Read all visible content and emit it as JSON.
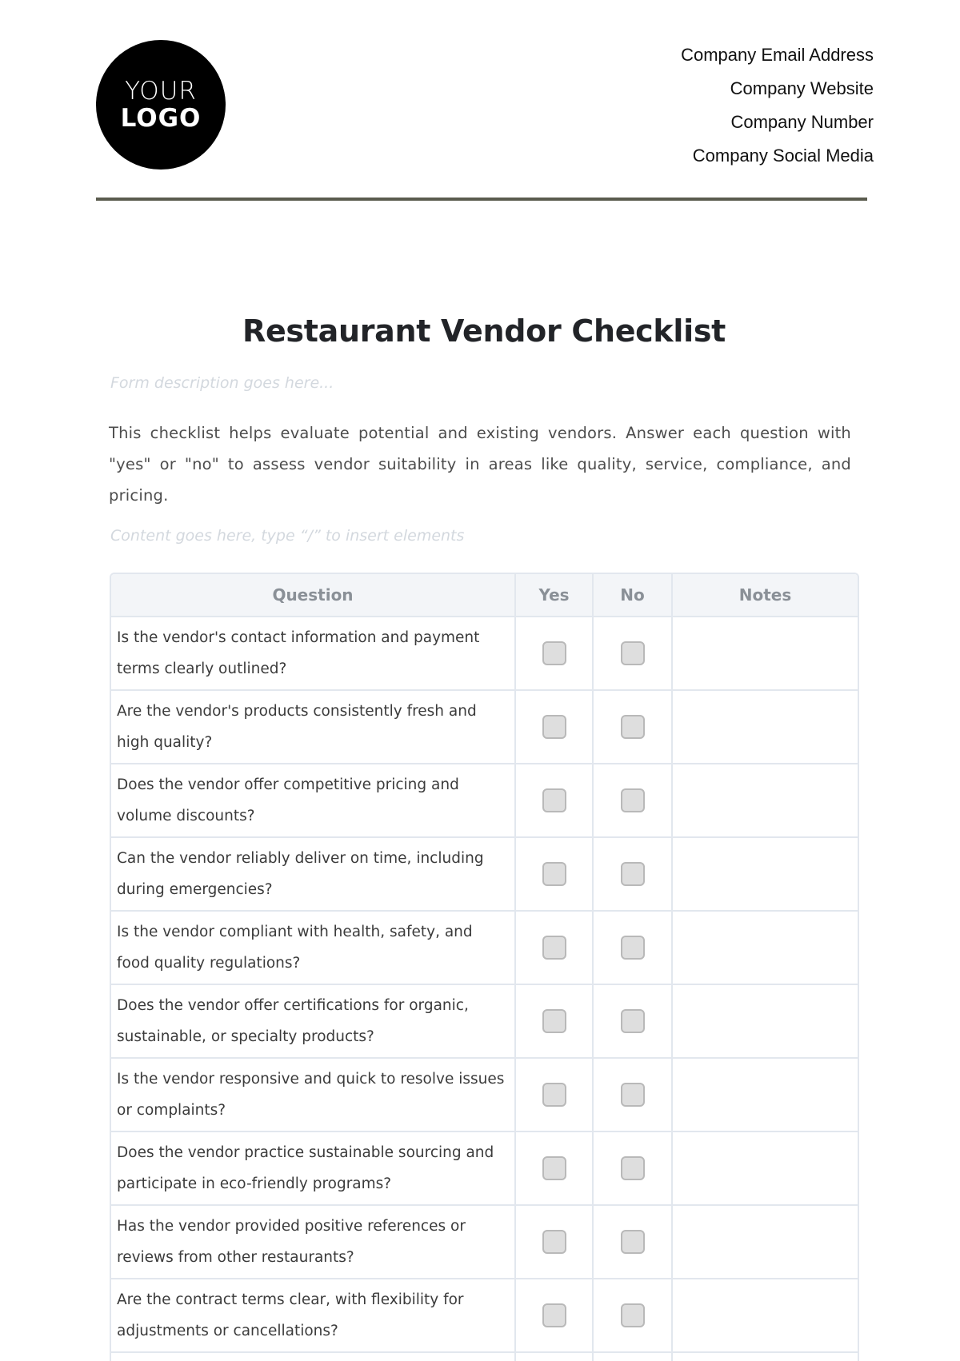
{
  "header": {
    "logo": {
      "line1": "YOUR",
      "line2": "LOGO"
    },
    "contact": [
      "Company Email Address",
      "Company Website",
      "Company Number",
      "Company Social Media"
    ]
  },
  "document": {
    "title": "Restaurant Vendor Checklist",
    "form_description_placeholder": "Form description goes here...",
    "intro": "This checklist helps evaluate potential and existing vendors. Answer each question with \"yes\" or \"no\" to assess vendor suitability in areas like quality, service, compliance, and pricing.",
    "content_placeholder": "Content goes here, type “/” to insert elements"
  },
  "table": {
    "headers": {
      "question": "Question",
      "yes": "Yes",
      "no": "No",
      "notes": "Notes"
    },
    "rows": [
      {
        "question": "Is the vendor's contact information and payment terms clearly outlined?",
        "yes": false,
        "no": false,
        "notes": ""
      },
      {
        "question": "Are the vendor's products consistently fresh and high quality?",
        "yes": false,
        "no": false,
        "notes": ""
      },
      {
        "question": "Does the vendor offer competitive pricing and volume discounts?",
        "yes": false,
        "no": false,
        "notes": ""
      },
      {
        "question": "Can the vendor reliably deliver on time, including during emergencies?",
        "yes": false,
        "no": false,
        "notes": ""
      },
      {
        "question": "Is the vendor compliant with health, safety, and food quality regulations?",
        "yes": false,
        "no": false,
        "notes": ""
      },
      {
        "question": "Does the vendor offer certifications for organic, sustainable, or specialty products?",
        "yes": false,
        "no": false,
        "notes": ""
      },
      {
        "question": "Is the vendor responsive and quick to resolve issues or complaints?",
        "yes": false,
        "no": false,
        "notes": ""
      },
      {
        "question": "Does the vendor practice sustainable sourcing and participate in eco-friendly programs?",
        "yes": false,
        "no": false,
        "notes": ""
      },
      {
        "question": "Has the vendor provided positive references or reviews from other restaurants?",
        "yes": false,
        "no": false,
        "notes": ""
      },
      {
        "question": "Are the contract terms clear, with flexibility for adjustments or cancellations?",
        "yes": false,
        "no": false,
        "notes": ""
      },
      {
        "question": "",
        "yes": false,
        "no": false,
        "notes": ""
      }
    ]
  }
}
